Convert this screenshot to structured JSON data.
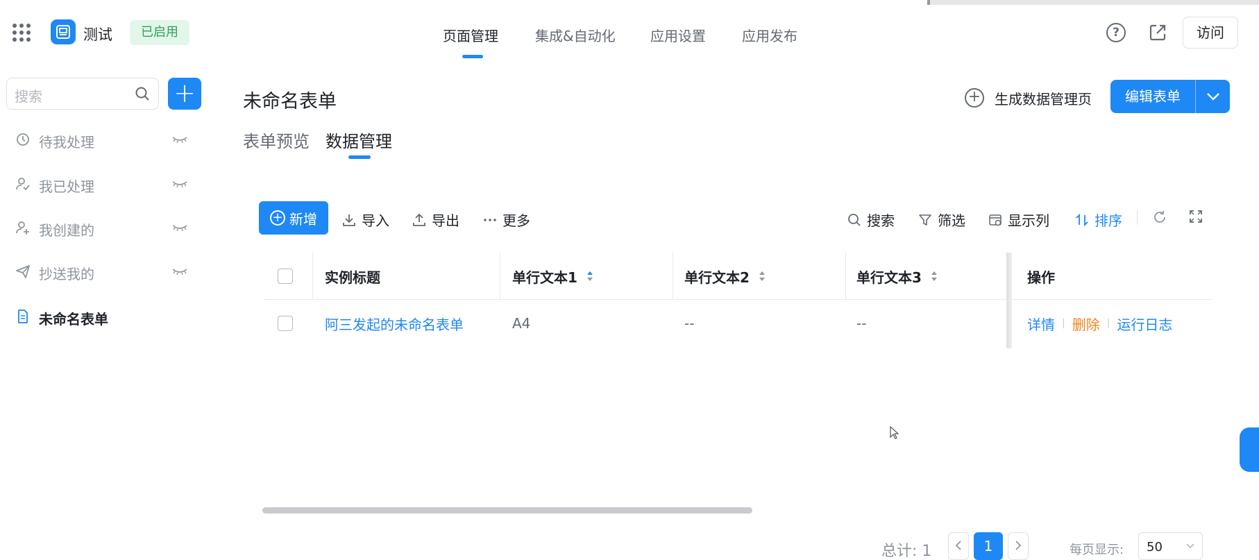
{
  "header": {
    "app_name": "测试",
    "status": "已启用",
    "nav": [
      "页面管理",
      "集成&自动化",
      "应用设置",
      "应用发布"
    ],
    "visit_label": "访问"
  },
  "sidebar": {
    "search_placeholder": "搜索",
    "add_label": "+",
    "items": [
      {
        "label": "待我处理",
        "icon": "clock-icon"
      },
      {
        "label": "我已处理",
        "icon": "user-check-icon"
      },
      {
        "label": "我创建的",
        "icon": "user-plus-icon"
      },
      {
        "label": "抄送我的",
        "icon": "send-icon"
      },
      {
        "label": "未命名表单",
        "icon": "document-icon"
      }
    ]
  },
  "main": {
    "title": "未命名表单",
    "generate_label": "生成数据管理页",
    "edit_label": "编辑表单",
    "tabs": [
      "表单预览",
      "数据管理"
    ]
  },
  "toolbar": {
    "new_label": "新增",
    "import_label": "导入",
    "export_label": "导出",
    "more_label": "更多",
    "search_label": "搜索",
    "filter_label": "筛选",
    "columns_label": "显示列",
    "sort_label": "排序"
  },
  "table": {
    "columns": [
      "实例标题",
      "单行文本1",
      "单行文本2",
      "单行文本3",
      "操作"
    ],
    "rows": [
      {
        "title": "阿三发起的未命名表单",
        "text1": "A4",
        "text2": "--",
        "text3": "--",
        "actions": [
          "详情",
          "删除",
          "运行日志"
        ]
      }
    ]
  },
  "pagination": {
    "total": "总计: 1",
    "current": "1",
    "per_page_label": "每页显示:",
    "per_page": "50"
  },
  "colors": {
    "accent": "#1e88f5",
    "status_green": "#2ea25a",
    "danger": "#f5841f"
  }
}
